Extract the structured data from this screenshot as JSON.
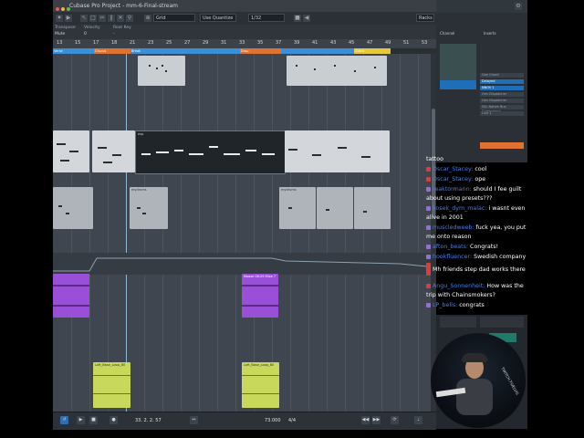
{
  "window": {
    "title": "Cubase Pro Project - mm-6-Final-stream"
  },
  "toolbar": {
    "grid_mode": "Grid",
    "quantize_mode": "Use Quantize",
    "quantize_value": "1/32",
    "right_button": "Racks"
  },
  "info_row": {
    "labels": [
      "Transpose",
      "Velocity",
      "Root Key"
    ],
    "values": [
      "Mute",
      "0",
      "-"
    ]
  },
  "ruler": {
    "numbers": [
      "13",
      "15",
      "17",
      "18",
      "21",
      "23",
      "25",
      "27",
      "29",
      "31",
      "33",
      "35",
      "37",
      "39",
      "41",
      "43",
      "45",
      "47",
      "49",
      "51",
      "53"
    ]
  },
  "clips": {
    "drum_clip_label": "mydrums",
    "midi_clip_label": "mydrums",
    "selected_clip_label": "exp",
    "synth_clip_label": "Moose 08-09 Mixe 7",
    "loop_clip_1_label": "Loft_Base_Loop_80",
    "loop_clip_2_label": "Loft_Base_Loop_80",
    "marker_labels": [
      "Verse",
      "Chorus",
      "Break",
      "Drop",
      "Outro"
    ]
  },
  "mixer": {
    "header_left": "Channel",
    "header_right": "Inserts",
    "rows": [
      "Gen Chord",
      "Delayed",
      "NNOV 1",
      "Gen Dispatcher",
      "Gen Dispatcher",
      "SSL Native Bus Compressor",
      "Line 1"
    ]
  },
  "chat": {
    "messages": [
      {
        "user": "",
        "text": "tattoo"
      },
      {
        "user": "Oscar_Stacey:",
        "text": "cool"
      },
      {
        "user": "Oscar_Stacey:",
        "text": "ope"
      },
      {
        "user": "reaktormann:",
        "text": "should I fee guilt about using presets???"
      },
      {
        "user": "kosek_dym_malac:",
        "text": "i wasnt even alive in 2001"
      },
      {
        "user": "muscledweeb:",
        "text": "fuck yea, you put me onto reason"
      },
      {
        "user": "afton_beats:",
        "text": "Congrats!"
      },
      {
        "user": "hookfluencer:",
        "text": "Swedish company"
      },
      {
        "user": "",
        "text": "Mh friends step dad works there"
      },
      {
        "user": "Angu_Sonnenheit:",
        "text": "How was the trip with Chainsmokers?"
      },
      {
        "user": "LP_bells:",
        "text": "congrats"
      }
    ]
  },
  "transport": {
    "position": "33. 2. 2. 57",
    "tempo": "73.000",
    "signature": "4/4"
  },
  "webcam": {
    "watermark": "TWITCH.TV/ELVIS"
  },
  "colors": {
    "accent_blue": "#3a8fd6",
    "clip_purple": "#9a4fd8",
    "clip_yellow": "#c8d85a",
    "marker_orange": "#e0722f",
    "marker_yellow": "#e6c93a",
    "chat_user": "#4a7fe0",
    "badge_red": "#e03a3a",
    "badge_purple": "#9a6ad8"
  }
}
